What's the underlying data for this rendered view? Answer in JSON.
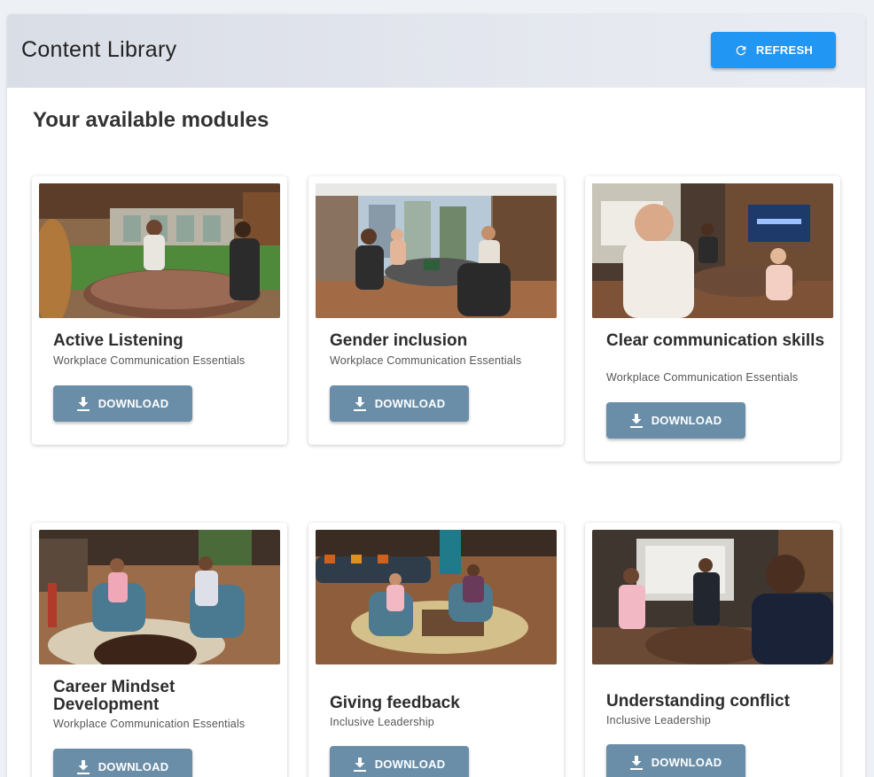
{
  "header": {
    "title": "Content Library",
    "refresh_label": "REFRESH",
    "refresh_icon": "refresh-icon",
    "accent": "#2196f3"
  },
  "section_title": "Your available modules",
  "download_color": "#6a8ea8",
  "cards": [
    {
      "title": "Active Listening",
      "subtitle": "Workplace Communication Essentials",
      "button": "DOWNLOAD",
      "icon": "download-icon"
    },
    {
      "title": "Gender inclusion",
      "subtitle": "Workplace Communication Essentials",
      "button": "DOWNLOAD",
      "icon": "download-icon"
    },
    {
      "title": "Clear communication skills",
      "subtitle": "Workplace Communication Essentials",
      "button": "DOWNLOAD",
      "icon": "download-icon"
    },
    {
      "title": "Career Mindset Development",
      "subtitle": "Workplace Communication Essentials",
      "button": "DOWNLOAD",
      "icon": "download-icon"
    },
    {
      "title": "Giving feedback",
      "subtitle": "Inclusive Leadership",
      "button": "DOWNLOAD",
      "icon": "download-icon"
    },
    {
      "title": "Understanding conflict",
      "subtitle": "Inclusive Leadership",
      "button": "DOWNLOAD",
      "icon": "download-icon"
    }
  ]
}
